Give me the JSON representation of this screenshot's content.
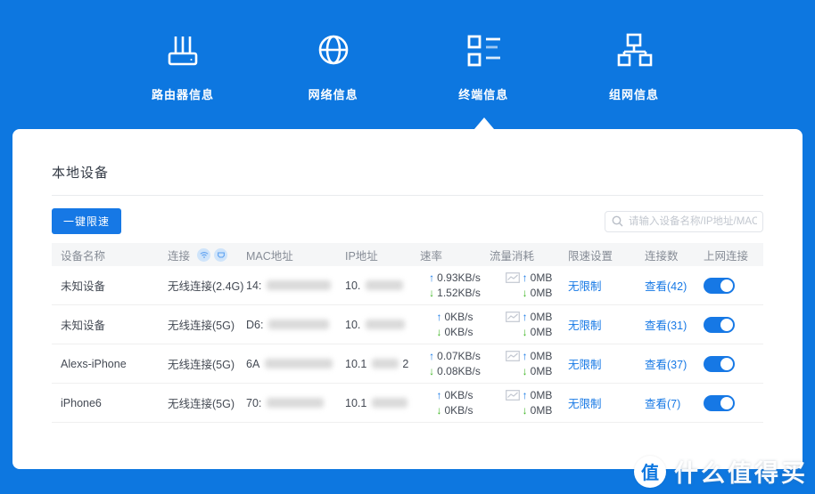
{
  "icons": {
    "up": "↑",
    "down": "↓"
  },
  "nav": {
    "tabs": [
      {
        "label": "路由器信息"
      },
      {
        "label": "网络信息"
      },
      {
        "label": "终端信息"
      },
      {
        "label": "组网信息"
      }
    ],
    "active_index": 2
  },
  "panel": {
    "title": "本地设备",
    "limit_button_label": "一键限速",
    "search_placeholder": "请输入设备名称/IP地址/MAC地址",
    "table": {
      "headers": [
        "设备名称",
        "连接",
        "MAC地址",
        "IP地址",
        "速率",
        "流量消耗",
        "限速设置",
        "连接数",
        "上网连接"
      ],
      "rows": [
        {
          "name": "未知设备",
          "connection": "无线连接(2.4G)",
          "mac_prefix": "14:",
          "ip_prefix": "10.",
          "ip_suffix": "",
          "up_speed": "0.93KB/s",
          "down_speed": "1.52KB/s",
          "up_traffic": "0MB",
          "down_traffic": "0MB",
          "limit": "无限制",
          "connections": "查看(42)",
          "internet_on": true
        },
        {
          "name": "未知设备",
          "connection": "无线连接(5G)",
          "mac_prefix": "D6:",
          "ip_prefix": "10.",
          "ip_suffix": "",
          "up_speed": "0KB/s",
          "down_speed": "0KB/s",
          "up_traffic": "0MB",
          "down_traffic": "0MB",
          "limit": "无限制",
          "connections": "查看(31)",
          "internet_on": true
        },
        {
          "name": "Alexs-iPhone",
          "connection": "无线连接(5G)",
          "mac_prefix": "6A",
          "ip_prefix": "10.1",
          "ip_suffix": "2",
          "up_speed": "0.07KB/s",
          "down_speed": "0.08KB/s",
          "up_traffic": "0MB",
          "down_traffic": "0MB",
          "limit": "无限制",
          "connections": "查看(37)",
          "internet_on": true
        },
        {
          "name": "iPhone6",
          "connection": "无线连接(5G)",
          "mac_prefix": "70:",
          "ip_prefix": "10.1",
          "ip_suffix": "",
          "up_speed": "0KB/s",
          "down_speed": "0KB/s",
          "up_traffic": "0MB",
          "down_traffic": "0MB",
          "limit": "无限制",
          "connections": "查看(7)",
          "internet_on": true
        }
      ]
    }
  },
  "watermark": {
    "logo_char": "值",
    "text": "什么值得买"
  },
  "colors": {
    "background_blue": "#0d77e0",
    "accent_blue": "#1678e5",
    "down_green": "#3cb521",
    "header_bg": "#f5f6f7"
  }
}
